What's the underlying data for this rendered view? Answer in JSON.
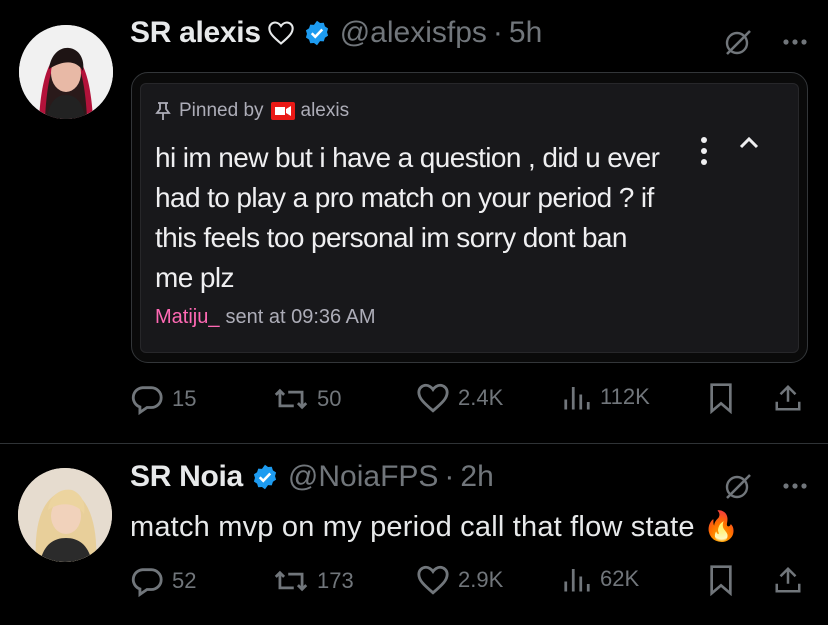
{
  "tweets": [
    {
      "name": "SR alexis",
      "handle": "@alexisfps",
      "time": "5h",
      "pinned": {
        "label": "Pinned by",
        "by": "alexis",
        "message": "hi im new but i have a question , did u ever had to play a pro match on your period ? if this feels too personal im sorry dont ban me plz",
        "sender": "Matiju_",
        "sent_at": "sent at 09:36 AM"
      },
      "stats": {
        "replies": "15",
        "reposts": "50",
        "likes": "2.4K",
        "views": "112K"
      }
    },
    {
      "name": "SR Noia",
      "handle": "@NoiaFPS",
      "time": "2h",
      "text": "match mvp on my period call that flow state",
      "emoji": "🔥",
      "stats": {
        "replies": "52",
        "reposts": "173",
        "likes": "2.9K",
        "views": "62K"
      }
    }
  ],
  "colors": {
    "verified": "#1d9bf0",
    "muted": "#71767b",
    "sender": "#ff69b4",
    "twitch_cam": "#e91916"
  },
  "icons": [
    "heart-outline-icon",
    "verified-badge-icon",
    "grok-icon",
    "more-icon",
    "pin-icon",
    "camera-icon",
    "kebab-icon",
    "caret-up-icon",
    "reply-icon",
    "repost-icon",
    "like-icon",
    "views-icon",
    "bookmark-icon",
    "share-icon",
    "fire-emoji"
  ]
}
